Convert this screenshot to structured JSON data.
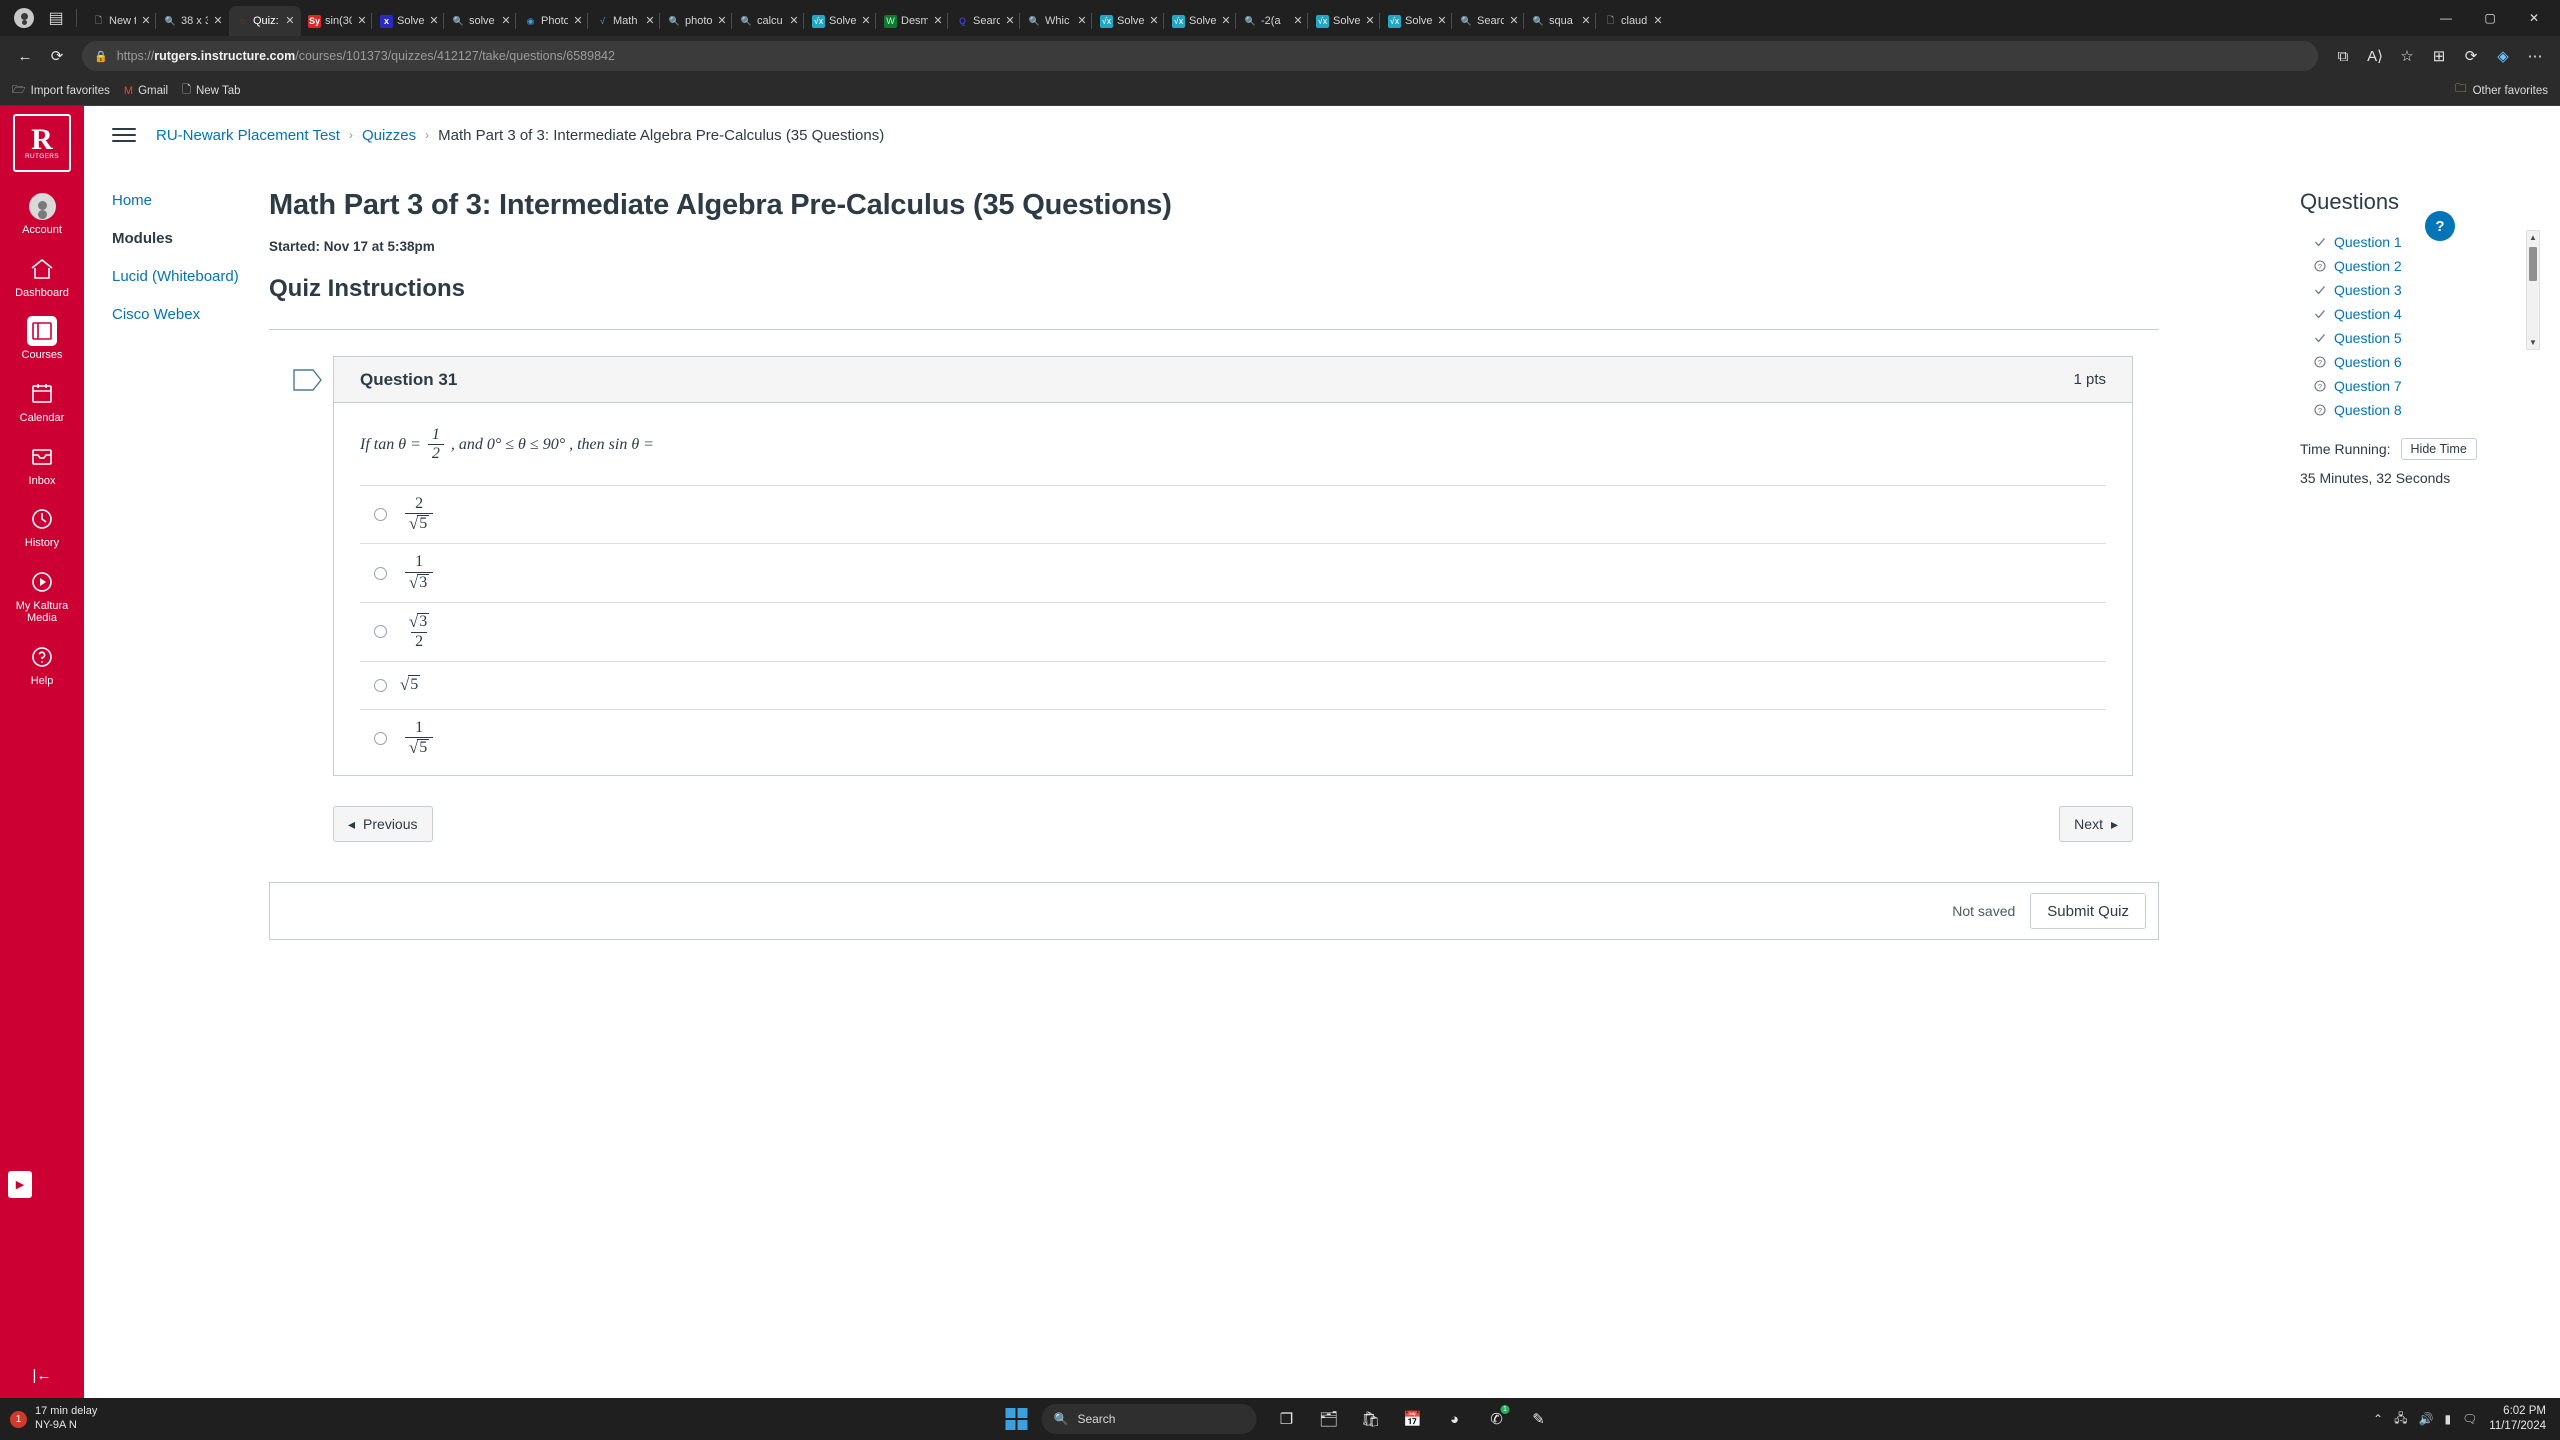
{
  "browser": {
    "tabs": [
      {
        "label": "New t",
        "icon": "page-icon",
        "iconclass": "fv-page",
        "active": false
      },
      {
        "label": "38 x 3",
        "icon": "search-icon",
        "iconclass": "fv-search",
        "active": false
      },
      {
        "label": "Quiz:",
        "icon": "canvas-icon",
        "iconclass": "fv-canvas",
        "active": true
      },
      {
        "label": "sin(30",
        "icon": "symbolab-sy-icon",
        "iconclass": "fv-sy",
        "active": false
      },
      {
        "label": "Solve",
        "icon": "mathway-icon",
        "iconclass": "fv-mathway",
        "active": false
      },
      {
        "label": "solve",
        "icon": "search-icon",
        "iconclass": "fv-search",
        "active": false
      },
      {
        "label": "Photo",
        "icon": "photomath-icon",
        "iconclass": "fv-photomath",
        "active": false
      },
      {
        "label": "Math",
        "icon": "mathpapa-icon",
        "iconclass": "fv-mathpapa",
        "active": false
      },
      {
        "label": "photo",
        "icon": "search-icon",
        "iconclass": "fv-search",
        "active": false
      },
      {
        "label": "calcu",
        "icon": "search-icon",
        "iconclass": "fv-search",
        "active": false
      },
      {
        "label": "Solve",
        "icon": "symbolab-icon",
        "iconclass": "fv-symbolab",
        "active": false
      },
      {
        "label": "Desm",
        "icon": "desmos-icon",
        "iconclass": "fv-desmos",
        "active": false
      },
      {
        "label": "Searc",
        "icon": "quora-icon",
        "iconclass": "fv-quora",
        "active": false
      },
      {
        "label": "Whic",
        "icon": "search-icon",
        "iconclass": "fv-search",
        "active": false
      },
      {
        "label": "Solve",
        "icon": "symbolab-icon",
        "iconclass": "fv-symbolab",
        "active": false
      },
      {
        "label": "Solve",
        "icon": "symbolab-icon",
        "iconclass": "fv-symbolab",
        "active": false
      },
      {
        "label": "-2(a",
        "icon": "search-icon",
        "iconclass": "fv-search",
        "active": false
      },
      {
        "label": "Solve",
        "icon": "symbolab-icon",
        "iconclass": "fv-symbolab",
        "active": false
      },
      {
        "label": "Solve",
        "icon": "symbolab-icon",
        "iconclass": "fv-symbolab",
        "active": false
      },
      {
        "label": "Searc",
        "icon": "search-icon",
        "iconclass": "fv-search",
        "active": false
      },
      {
        "label": "squa",
        "icon": "search-icon",
        "iconclass": "fv-search",
        "active": false
      },
      {
        "label": "claud",
        "icon": "claude-icon",
        "iconclass": "fv-page",
        "active": false
      }
    ],
    "close_glyph": "✕",
    "window": {
      "minimize": "—",
      "maximize": "▢",
      "close": "✕"
    },
    "url": {
      "scheme": "https://",
      "domain": "rutgers.instructure.com",
      "path": "/courses/101373/quizzes/412127/take/questions/6589842"
    },
    "bookmarks": [
      {
        "label": "Import favorites",
        "icon": "import-icon"
      },
      {
        "label": "Gmail",
        "icon": "gmail-icon"
      },
      {
        "label": "New Tab",
        "icon": "page-icon"
      }
    ],
    "other_favorites": "Other favorites",
    "back_glyph": "←",
    "reload_glyph": "⟳",
    "lock_glyph": "🔒"
  },
  "canvas_nav": {
    "logo_letter": "R",
    "logo_name": "RUTGERS",
    "items": [
      {
        "label": "Account",
        "icon": "avatar-icon",
        "active": false
      },
      {
        "label": "Dashboard",
        "icon": "dashboard-icon",
        "active": false
      },
      {
        "label": "Courses",
        "icon": "courses-icon",
        "active": true
      },
      {
        "label": "Calendar",
        "icon": "calendar-icon",
        "active": false
      },
      {
        "label": "Inbox",
        "icon": "inbox-icon",
        "active": false
      },
      {
        "label": "History",
        "icon": "history-icon",
        "active": false
      },
      {
        "label": "My Kaltura Media",
        "icon": "kaltura-icon",
        "active": false
      },
      {
        "label": "Help",
        "icon": "help-icon",
        "active": false
      }
    ],
    "collapse_glyph": "|←",
    "expand_glyph": "▶"
  },
  "breadcrumb": {
    "items": [
      {
        "label": "RU-Newark Placement Test",
        "link": true
      },
      {
        "label": "Quizzes",
        "link": true
      },
      {
        "label": "Math Part 3 of 3: Intermediate Algebra Pre-Calculus (35 Questions)",
        "link": false
      }
    ],
    "separator": "›"
  },
  "course_nav": [
    {
      "label": "Home",
      "active": false
    },
    {
      "label": "Modules",
      "active": true
    },
    {
      "label": "Lucid (Whiteboard)",
      "active": false
    },
    {
      "label": "Cisco Webex",
      "active": false
    }
  ],
  "quiz": {
    "title": "Math Part 3 of 3: Intermediate Algebra Pre-Calculus (35 Questions)",
    "started": "Started: Nov 17 at 5:38pm",
    "instructions_heading": "Quiz Instructions",
    "question_name": "Question 31",
    "points": "1 pts",
    "prompt": {
      "lead": "If tan θ =",
      "frac_num": "1",
      "frac_den": "2",
      "mid": ", and 0° ≤ θ ≤ 90° , then sin θ ="
    },
    "answers": [
      {
        "type": "fraction",
        "num": "2",
        "den_root": "5"
      },
      {
        "type": "fraction",
        "num": "1",
        "den_root": "3"
      },
      {
        "type": "fraction_root_num",
        "num_root": "3",
        "den": "2"
      },
      {
        "type": "root",
        "root": "5"
      },
      {
        "type": "fraction",
        "num": "1",
        "den_root": "5"
      }
    ],
    "previous_label": "Previous",
    "next_label": "Next",
    "prev_arrow": "◂",
    "next_arrow": "▸",
    "not_saved": "Not saved",
    "submit_label": "Submit Quiz"
  },
  "questions_panel": {
    "heading": "Questions",
    "items": [
      {
        "label": "Question 1",
        "status": "answered",
        "mark": "✓"
      },
      {
        "label": "Question 2",
        "status": "unanswered",
        "mark": "?"
      },
      {
        "label": "Question 3",
        "status": "answered",
        "mark": "✓"
      },
      {
        "label": "Question 4",
        "status": "answered",
        "mark": "✓"
      },
      {
        "label": "Question 5",
        "status": "answered",
        "mark": "✓"
      },
      {
        "label": "Question 6",
        "status": "unanswered",
        "mark": "?"
      },
      {
        "label": "Question 7",
        "status": "unanswered",
        "mark": "?"
      },
      {
        "label": "Question 8",
        "status": "unanswered",
        "mark": "?"
      }
    ],
    "time_label": "Time Running:",
    "hide_time_label": "Hide Time",
    "time_value": "35 Minutes, 32 Seconds",
    "scroll_up": "▲",
    "scroll_down": "▼"
  },
  "help_badge": "?",
  "taskbar": {
    "delay_count": "1",
    "delay_text": "17 min delay",
    "region_text": "NY-9A N",
    "search_placeholder": "Search",
    "time": "6:02 PM",
    "date": "11/17/2024",
    "apps": [
      {
        "name": "task-view-icon",
        "glyph": "❐"
      },
      {
        "name": "file-explorer-icon",
        "glyph": "🗂"
      },
      {
        "name": "store-icon",
        "glyph": "🛍"
      },
      {
        "name": "calendar-icon",
        "glyph": "📅"
      },
      {
        "name": "edge-icon",
        "glyph": "◕"
      },
      {
        "name": "whatsapp-icon",
        "glyph": "✆",
        "badge": "1"
      },
      {
        "name": "snip-icon",
        "glyph": "✎"
      }
    ],
    "tray": [
      {
        "name": "show-hidden-icon",
        "glyph": "⌃"
      },
      {
        "name": "network-icon",
        "glyph": "🖧"
      },
      {
        "name": "sound-icon",
        "glyph": "🔊"
      },
      {
        "name": "battery-icon",
        "glyph": "▮"
      },
      {
        "name": "notification-icon",
        "glyph": "🗨"
      }
    ]
  },
  "colors": {
    "rutgers_red": "#cc0033",
    "canvas_link": "#0374b5",
    "text": "#2d3b45"
  }
}
